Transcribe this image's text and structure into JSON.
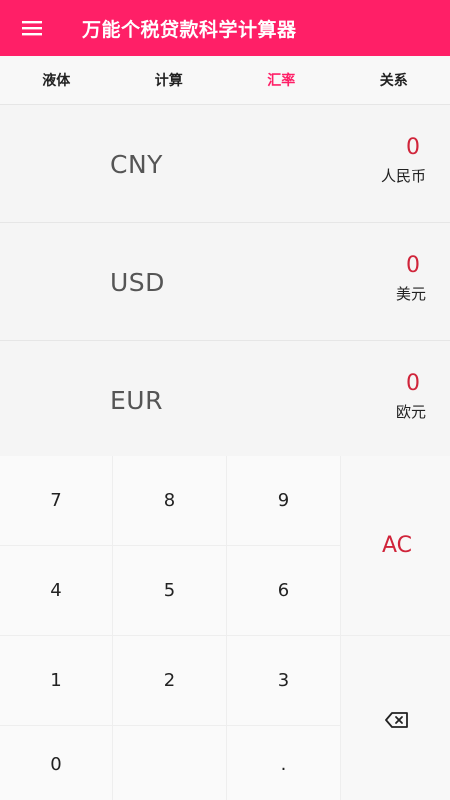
{
  "header": {
    "title": "万能个税贷款科学计算器",
    "menu_icon": "hamburger-menu-icon",
    "background_color": "#ff1f67"
  },
  "tabs": [
    {
      "label": "液体",
      "active": false
    },
    {
      "label": "计算",
      "active": false
    },
    {
      "label": "汇率",
      "active": true
    },
    {
      "label": "关系",
      "active": false
    }
  ],
  "currencies": [
    {
      "code": "CNY",
      "value": "0",
      "name": "人民币"
    },
    {
      "code": "USD",
      "value": "0",
      "name": "美元"
    },
    {
      "code": "EUR",
      "value": "0",
      "name": "欧元"
    }
  ],
  "keypad": {
    "row1": [
      "7",
      "8",
      "9"
    ],
    "row2": [
      "4",
      "5",
      "6"
    ],
    "row3": [
      "1",
      "2",
      "3"
    ],
    "zero": "0",
    "dot": ".",
    "clear": "AC",
    "backspace_icon": "backspace-icon"
  },
  "colors": {
    "accent": "#ff1f67",
    "value_red": "#d0243a"
  }
}
